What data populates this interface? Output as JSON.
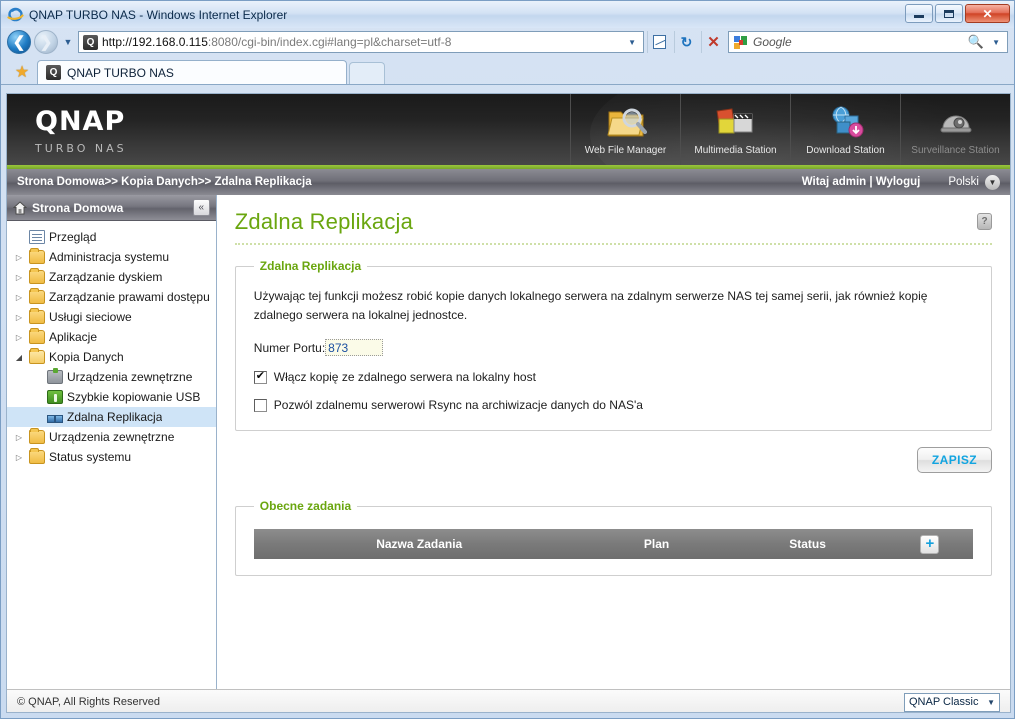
{
  "browser": {
    "window_title": "QNAP TURBO NAS - Windows Internet Explorer",
    "ie_icon": "internet-explorer-icon",
    "minimize_label": "Minimize",
    "maximize_label": "Maximize",
    "close_label": "Close",
    "back_label": "Back",
    "forward_label": "Forward",
    "history_label": "Recent pages",
    "url_prefix": "http://192.168.0.115",
    "url_suffix": ":8080/cgi-bin/index.cgi#lang=pl&charset=utf-8",
    "url_full": "http://192.168.0.115:8080/cgi-bin/index.cgi#lang=pl&charset=utf-8",
    "address_dropdown": "▼",
    "compatibility_label": "Compatibility View",
    "refresh_label": "Refresh",
    "stop_label": "Stop",
    "search_placeholder": "Google",
    "search_value": "",
    "search_go": "Search",
    "search_dropdown": "▼",
    "favorites_label": "Favorites",
    "tab_title": "QNAP TURBO NAS",
    "new_tab_label": "New Tab",
    "favicon_letter": "Q"
  },
  "banner": {
    "logo": "QNAP",
    "logo_sub": "TURBO NAS",
    "stations": [
      {
        "label": "Web File Manager",
        "icon": "folder-search-icon",
        "disabled": false
      },
      {
        "label": "Multimedia Station",
        "icon": "multimedia-icon",
        "disabled": false
      },
      {
        "label": "Download Station",
        "icon": "download-globe-icon",
        "disabled": false
      },
      {
        "label": "Surveillance Station",
        "icon": "camera-dome-icon",
        "disabled": true
      }
    ]
  },
  "crumbbar": {
    "breadcrumb": "Strona Domowa>> Kopia Danych>> Zdalna Replikacja",
    "user_text": "Witaj admin | Wyloguj",
    "language": "Polski"
  },
  "sidebar": {
    "header": "Strona Domowa",
    "home_icon": "home-icon",
    "collapse_icon": "collapse-left-icon",
    "items": [
      {
        "label": "Przegląd",
        "icon": "overview-icon",
        "indent": 1,
        "arrow": "",
        "selected": false
      },
      {
        "label": "Administracja systemu",
        "icon": "folder-icon",
        "indent": 0,
        "arrow": "▷",
        "selected": false
      },
      {
        "label": "Zarządzanie dyskiem",
        "icon": "folder-icon",
        "indent": 0,
        "arrow": "▷",
        "selected": false
      },
      {
        "label": "Zarządzanie prawami dostępu",
        "icon": "folder-icon",
        "indent": 0,
        "arrow": "▷",
        "selected": false
      },
      {
        "label": "Usługi sieciowe",
        "icon": "folder-icon",
        "indent": 0,
        "arrow": "▷",
        "selected": false
      },
      {
        "label": "Aplikacje",
        "icon": "folder-icon",
        "indent": 0,
        "arrow": "▷",
        "selected": false
      },
      {
        "label": "Kopia Danych",
        "icon": "folder-open-icon",
        "indent": 0,
        "arrow": "◢",
        "selected": false
      },
      {
        "label": "Urządzenia zewnętrzne",
        "icon": "external-device-icon",
        "indent": 2,
        "arrow": "",
        "selected": false
      },
      {
        "label": "Szybkie kopiowanie USB",
        "icon": "usb-icon",
        "indent": 2,
        "arrow": "",
        "selected": false
      },
      {
        "label": "Zdalna Replikacja",
        "icon": "replication-icon",
        "indent": 2,
        "arrow": "",
        "selected": true
      },
      {
        "label": "Urządzenia zewnętrzne",
        "icon": "folder-icon",
        "indent": 0,
        "arrow": "▷",
        "selected": false
      },
      {
        "label": "Status systemu",
        "icon": "folder-icon",
        "indent": 0,
        "arrow": "▷",
        "selected": false
      }
    ]
  },
  "page": {
    "title": "Zdalna Replikacja",
    "help_glyph": "?",
    "panel_legend": "Zdalna Replikacja",
    "description": "Używając tej funkcji możesz robić kopie danych lokalnego serwera na zdalnym serwerze NAS tej samej serii, jak również kopię zdalnego serwera na lokalnej jednostce.",
    "port_label": "Numer Portu:",
    "port_value": "873",
    "checkbox_enable_label": "Włącz kopię ze zdalnego serwera na lokalny host",
    "checkbox_enable_checked": true,
    "checkbox_rsync_label": "Pozwól zdalnemu serwerowi Rsync na archiwizacje danych do NAS'a",
    "checkbox_rsync_checked": false,
    "save_label": "ZAPISZ"
  },
  "tasks": {
    "legend": "Obecne zadania",
    "columns": [
      "Nazwa Zadania",
      "Plan",
      "Status"
    ],
    "add_glyph": "+",
    "rows": []
  },
  "footer": {
    "copyright": "© QNAP, All Rights Reserved",
    "theme": "QNAP Classic",
    "theme_caret": "▼"
  },
  "colors": {
    "accent_green": "#6aa60f",
    "banner_green_line": "#9ac63e",
    "link_blue": "#11a4e0",
    "input_text_blue": "#1b4fa0",
    "selected_row": "#cfe4f7"
  }
}
